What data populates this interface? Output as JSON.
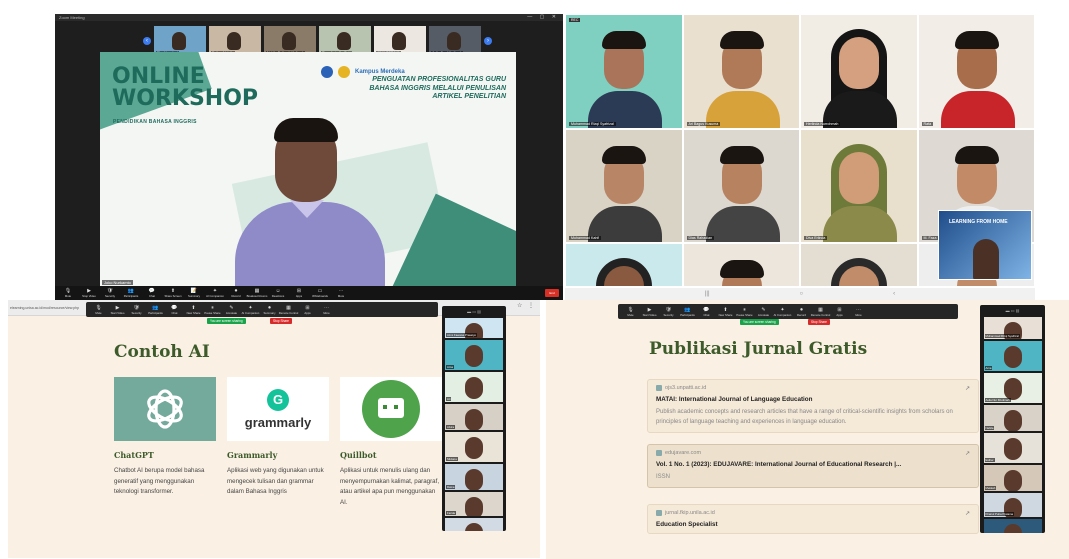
{
  "panel_a": {
    "window_title": "Zoom Meeting",
    "thumbnails": [
      {
        "label": "Eko Hamdani",
        "bg": "#6fa3c7"
      },
      {
        "label": "Esther Natalia",
        "bg": "#c9b8a4"
      },
      {
        "label": "Nabila Fatimah Kalimah",
        "bg": "#8a7a68"
      },
      {
        "label": "Tiara Anindita Putri",
        "bg": "#b9c4b0"
      },
      {
        "label": "AINA SORAYA",
        "bg": "#ece7e0"
      },
      {
        "label": "Aulia Nur Khotimah",
        "bg": "#555c66"
      }
    ],
    "slide": {
      "title": "ONLINE WORKSHOP",
      "subtitle": "PENDIDIKAN BAHASA INGGRIS",
      "kampus": "Kampus Merdeka",
      "heading": "PENGUATAN PROFESIONALITAS GURU BAHASA INGGRIS MELALUI PENULISAN ARTIKEL PENELITIAN"
    },
    "speaker_name": "Joko Nurkamto",
    "toolbar": [
      {
        "icon": "🎙",
        "label": "Mute"
      },
      {
        "icon": "▶",
        "label": "Stop Video"
      },
      {
        "icon": "🛡",
        "label": "Security"
      },
      {
        "icon": "👥",
        "label": "Participants"
      },
      {
        "icon": "💬",
        "label": "Chat"
      },
      {
        "icon": "⬆",
        "label": "Share Screen"
      },
      {
        "icon": "📝",
        "label": "Summary"
      },
      {
        "icon": "✦",
        "label": "AI Companion"
      },
      {
        "icon": "⏺",
        "label": "Record"
      },
      {
        "icon": "▦",
        "label": "Breakout Rooms"
      },
      {
        "icon": "☺",
        "label": "Reactions"
      },
      {
        "icon": "⊞",
        "label": "Apps"
      },
      {
        "icon": "▭",
        "label": "Whiteboards"
      },
      {
        "icon": "⋯",
        "label": "More"
      }
    ],
    "end_label": "End"
  },
  "panel_b": {
    "rec_label": "REC",
    "tiles": [
      {
        "label": "Muhammad Rizqi Syafrizal",
        "bg": "#7fd0c0",
        "skin": "#a9745a",
        "shirt": "#2b3a55",
        "hijab": ""
      },
      {
        "label": "Ari Bagus Kusuma",
        "bg": "#e9e0d0",
        "skin": "#b07a58",
        "shirt": "#d7a23a",
        "hijab": ""
      },
      {
        "label": "Herlinda Nurrohmah",
        "bg": "#f1ece4",
        "skin": "#d4a080",
        "shirt": "#1a1a1a",
        "hijab": "#151515"
      },
      {
        "label": "Rafa",
        "bg": "#f2ede6",
        "skin": "#a86e4c",
        "shirt": "#c8252b",
        "hijab": ""
      },
      {
        "label": "Muhammad Kahfi",
        "bg": "#d9d3c6",
        "skin": "#b88666",
        "shirt": "#3c3c3c",
        "hijab": ""
      },
      {
        "label": "Dias Rahadian",
        "bg": "#dcd8d0",
        "skin": "#b78260",
        "shirt": "#444444",
        "hijab": ""
      },
      {
        "label": "Diva Erlinda",
        "bg": "#e8e0cc",
        "skin": "#d09d78",
        "shirt": "#8c8a4a",
        "hijab": "#6e7a3a"
      },
      {
        "label": "M. Faza",
        "bg": "#ded9d2",
        "skin": "#c28a66",
        "shirt": "#eeeeee",
        "hijab": ""
      },
      {
        "label": "",
        "bg": "#c9e9ec",
        "skin": "#8a5a40",
        "shirt": "#2a2a2a",
        "hijab": "#222222"
      },
      {
        "label": "",
        "bg": "#ece6dc",
        "skin": "#b07a58",
        "shirt": "#333333",
        "hijab": ""
      },
      {
        "label": "",
        "bg": "#e4ddd2",
        "skin": "#c08c6a",
        "shirt": "#333333",
        "hijab": "#2a2a2a"
      },
      {
        "label": "",
        "bg": "#eeeeee",
        "skin": "#c08c6a",
        "shirt": "#333333",
        "hijab": ""
      }
    ],
    "pip_text": "LEARNING FROM HOME"
  },
  "strip_icons": [
    "|||",
    "○",
    "‹"
  ],
  "panel_c": {
    "url": "elearning.unisa.ac.id/mod/resource/view.php",
    "toolbar": [
      {
        "icon": "🎙",
        "label": "Mute"
      },
      {
        "icon": "▶",
        "label": "Start Video"
      },
      {
        "icon": "🛡",
        "label": "Security"
      },
      {
        "icon": "👥",
        "label": "Participants"
      },
      {
        "icon": "💬",
        "label": "Chat"
      },
      {
        "icon": "⬆",
        "label": "New Share"
      },
      {
        "icon": "⏸",
        "label": "Pause Share"
      },
      {
        "icon": "✎",
        "label": "Annotate"
      },
      {
        "icon": "✦",
        "label": "AI Companion"
      },
      {
        "icon": "⏺",
        "label": "Summary"
      },
      {
        "icon": "▦",
        "label": "Remote Control"
      },
      {
        "icon": "⊞",
        "label": "Apps"
      },
      {
        "icon": "⋯",
        "label": "More"
      }
    ],
    "share_status": "You are screen sharing",
    "stop_share": "Stop Share",
    "heading": "Contoh AI",
    "cards": [
      {
        "name": "ChatGPT",
        "desc": "Chatbot AI berupa model bahasa generatif yang menggunakan teknologi transformer."
      },
      {
        "name": "Grammarly",
        "desc": "Aplikasi web yang digunakan untuk mengecek tulisan dan grammar dalam Bahasa Inggris"
      },
      {
        "name": "Quillbot",
        "desc": "Aplikasi untuk menulis ulang dan menyempurnakan kalimat, paragraf, atau artikel apa pun menggunakan AI."
      }
    ],
    "grammarly_logo_text": "grammarly",
    "side_tiles": [
      {
        "label": "Azmi Fawwas Prasetyo",
        "bg": "#cfe6f2"
      },
      {
        "label": "Arna",
        "bg": "#4fb5c4"
      },
      {
        "label": "Ari",
        "bg": "#e4efe4"
      },
      {
        "label": "Alvira",
        "bg": "#d6d0c6"
      },
      {
        "label": "Silviana",
        "bg": "#e9e3d8"
      },
      {
        "label": "Ratna",
        "bg": "#c8d4e0"
      },
      {
        "label": "Farida",
        "bg": "#ddd6cc"
      },
      {
        "label": "Dwi",
        "bg": "#d2dbe4"
      }
    ]
  },
  "panel_d": {
    "toolbar": [
      {
        "icon": "🎙",
        "label": "Mute"
      },
      {
        "icon": "▶",
        "label": "Start Video"
      },
      {
        "icon": "🛡",
        "label": "Security"
      },
      {
        "icon": "👥",
        "label": "Participants"
      },
      {
        "icon": "💬",
        "label": "Chat"
      },
      {
        "icon": "⬆",
        "label": "New Share"
      },
      {
        "icon": "⏸",
        "label": "Pause Share"
      },
      {
        "icon": "✎",
        "label": "Annotate"
      },
      {
        "icon": "✦",
        "label": "AI Companion"
      },
      {
        "icon": "⏺",
        "label": "Record"
      },
      {
        "icon": "▦",
        "label": "Remote Control"
      },
      {
        "icon": "⊞",
        "label": "Apps"
      },
      {
        "icon": "⋯",
        "label": "More"
      }
    ],
    "share_status": "You are screen sharing",
    "stop_share": "Stop Share",
    "heading": "Publikasi Jurnal Gratis",
    "journals": [
      {
        "domain": "ojs3.unpatti.ac.id",
        "title": "MATAI: International Journal of Language Education",
        "desc": "Publish academic concepts and research articles that have a range of critical-scientific insights from scholars on principles of language teaching and experiences in language education."
      },
      {
        "domain": "edujavare.com",
        "title": "Vol. 1 No. 1 (2023): EDUJAVARE: International Journal of Educational Research |...",
        "desc": "ISSN"
      },
      {
        "domain": "jurnal.fkip.unila.ac.id",
        "title": "Education Specialist",
        "desc": ""
      }
    ],
    "side_tiles": [
      {
        "label": "Muhammad Rizqi Syafrizal",
        "bg": "#e8e0d6"
      },
      {
        "label": "Arna",
        "bg": "#4fb5c4"
      },
      {
        "label": "Aulia Nur Khotimah",
        "bg": "#e8efe4"
      },
      {
        "label": "Nabila",
        "bg": "#d8d2c8"
      },
      {
        "label": "Esther",
        "bg": "#e6e2da"
      },
      {
        "label": "Mekkah",
        "bg": "#d6c8b8"
      },
      {
        "label": "Khairul Putra Pratama",
        "bg": "#cfd8e0"
      },
      {
        "label": "Dias",
        "bg": "#2d5a7a"
      }
    ]
  }
}
